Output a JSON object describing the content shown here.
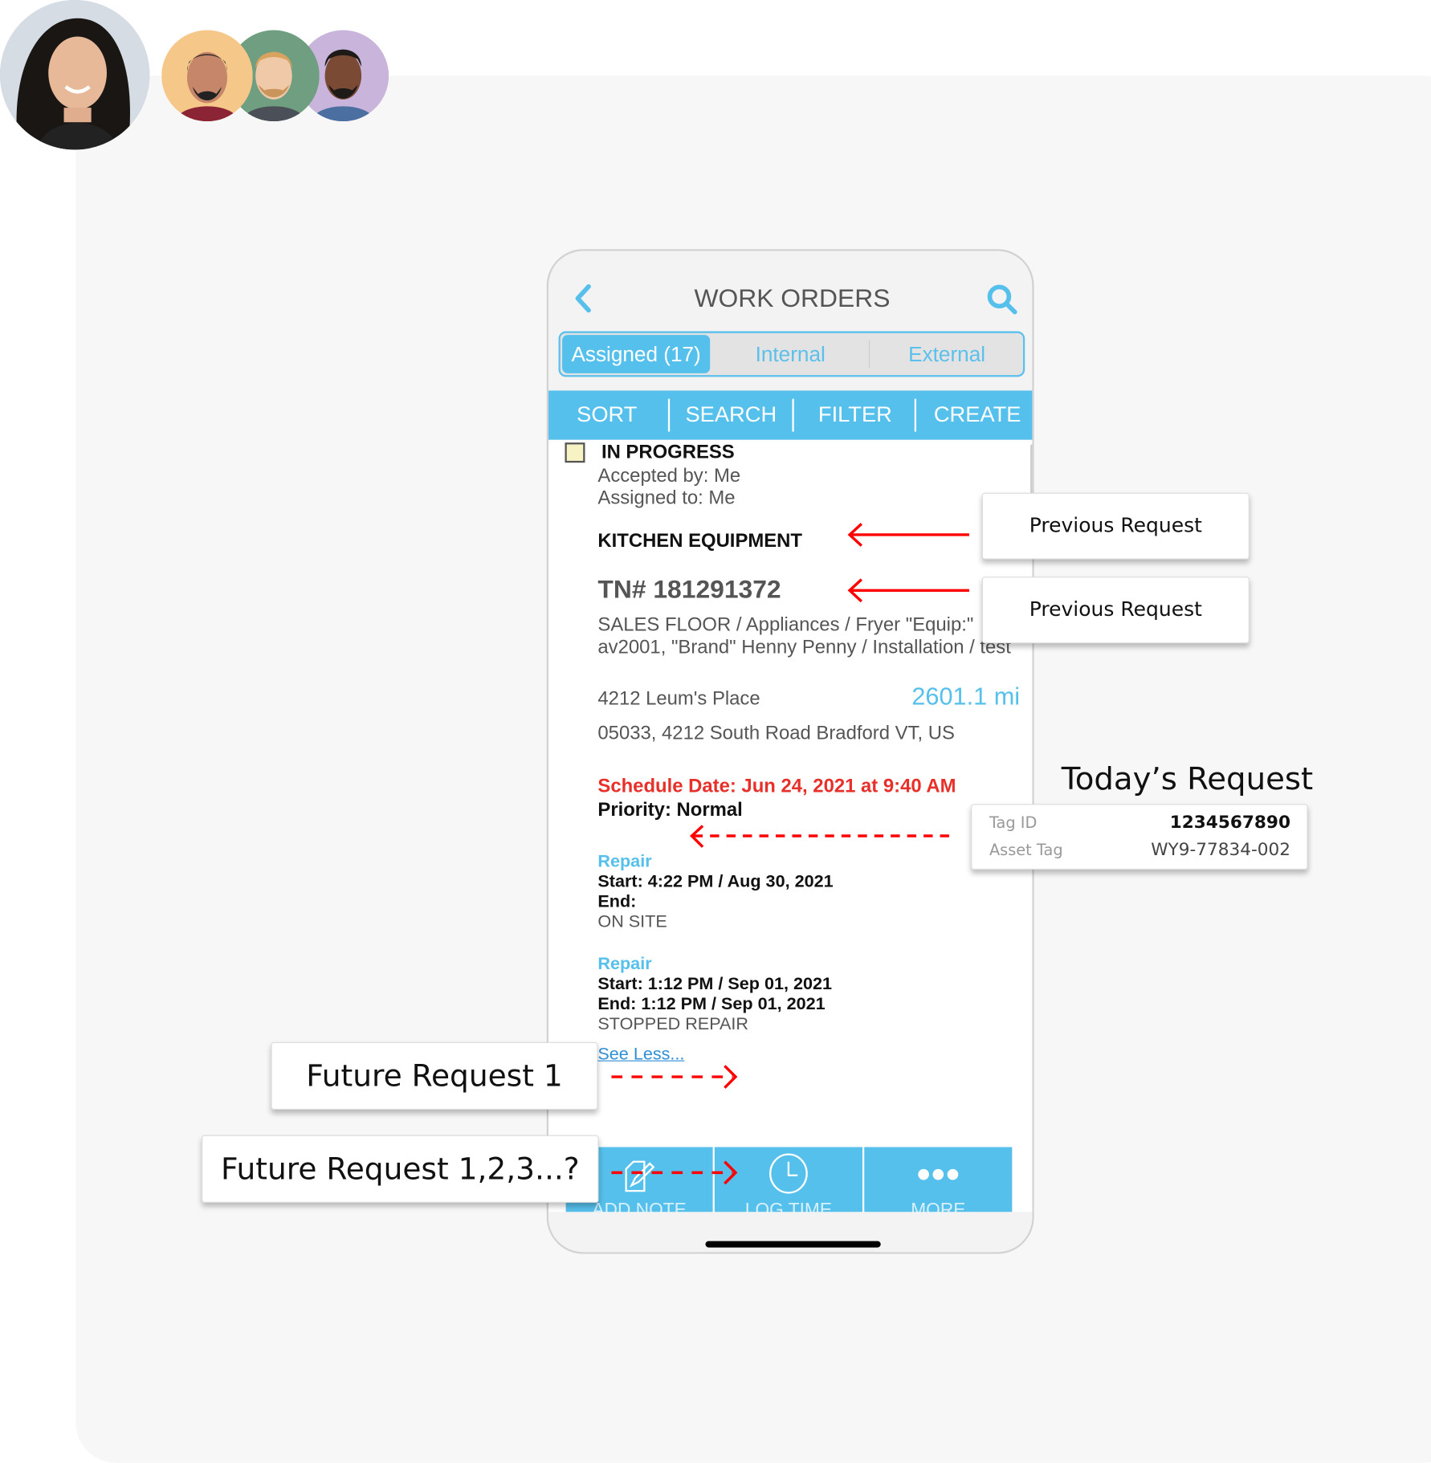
{
  "phone": {
    "title": "WORK ORDERS",
    "segments": [
      "Assigned (17)",
      "Internal",
      "External"
    ],
    "toolbar": [
      "SORT",
      "SEARCH",
      "FILTER",
      "CREATE"
    ],
    "order": {
      "status": "IN PROGRESS",
      "accepted_by": "Accepted by:  Me",
      "assigned_to": "Assigned to:  Me",
      "category": "KITCHEN EQUIPMENT",
      "tn": "TN#  181291372",
      "desc_line1": "SALES FLOOR / Appliances / Fryer \"Equip:\"",
      "desc_line2": "av2001, \"Brand\" Henny Penny / Installation / test",
      "location": "4212 Leum's Place",
      "distance": "2601.1 mi",
      "address": "05033, 4212 South Road Bradford VT, US",
      "schedule": "Schedule Date: Jun 24, 2021 at 9:40 AM",
      "priority": "Priority:  Normal",
      "visits": [
        {
          "type": "Repair",
          "start": "Start: 4:22 PM / Aug 30, 2021",
          "end": "End:",
          "status": "ON SITE"
        },
        {
          "type": "Repair",
          "start": "Start: 1:12 PM / Sep 01, 2021",
          "end": "End: 1:12 PM / Sep 01, 2021",
          "status": "STOPPED REPAIR"
        }
      ],
      "see_less": "See Less..."
    },
    "bottom_bar": [
      "ADD NOTE",
      "LOG TIME",
      "MORE"
    ]
  },
  "annotations": {
    "previous_1": "Previous Request",
    "previous_2": "Previous Request",
    "today_title": "Today’s Request",
    "tag_id_label": "Tag ID",
    "tag_id_value": "1234567890",
    "asset_tag_label": "Asset Tag",
    "asset_tag_value": "WY9-77834-002",
    "future_1": "Future Request 1",
    "future_many": "Future Request 1,2,3...?"
  },
  "colors": {
    "accent": "#56c0ec",
    "alert": "#e8302a",
    "annotation_arrow": "#ff0000"
  }
}
